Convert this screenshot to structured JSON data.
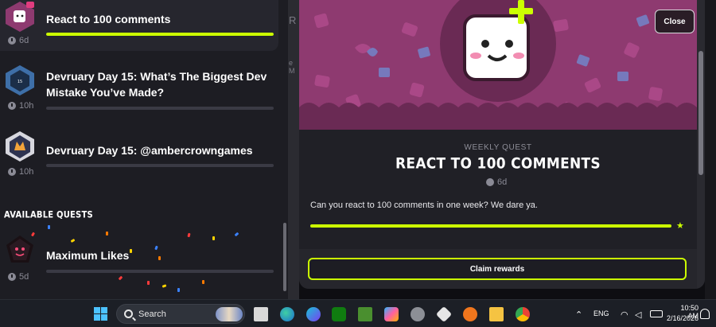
{
  "left_panel": {
    "active_quests": [
      {
        "title": "React to 100 comments",
        "time": "6d",
        "progress": 1.0,
        "badge": "react-quest-badge"
      },
      {
        "title": "Devruary Day 15: What’s The Biggest Dev Mistake You’ve Made?",
        "time": "10h",
        "progress": 0,
        "badge": "devruary-badge"
      },
      {
        "title": "Devruary Day 15: @ambercrowngames",
        "time": "10h",
        "progress": 0,
        "badge": "ambercrown-badge"
      }
    ],
    "available_label": "AVAILABLE QUESTS",
    "available_quests": [
      {
        "title": "Maximum Likes",
        "time": "5d",
        "progress": 0,
        "badge": "likes-badge"
      }
    ]
  },
  "background": {
    "letter_r": "R",
    "letter_m": "e M"
  },
  "modal": {
    "close_label": "Close",
    "kicker": "WEEKLY QUEST",
    "title": "REACT TO 100 COMMENTS",
    "time": "6d",
    "description": "Can you react to 100 comments in one week? We dare ya.",
    "progress": 1.0,
    "claim_label": "Claim rewards"
  },
  "taskbar": {
    "search_placeholder": "Search",
    "language": "ENG",
    "time": "10:50 AM",
    "date": "2/16/2026",
    "pinned": [
      "file-view-icon",
      "edge-icon",
      "canva-icon",
      "xbox-icon",
      "minecraft-icon",
      "copilot-icon",
      "settings-icon",
      "unity-icon",
      "blender-icon",
      "file-explorer-icon",
      "chrome-icon"
    ]
  },
  "colors": {
    "accent": "#ccff00",
    "hero": "#8e3a70",
    "panel": "#1d1d23"
  }
}
